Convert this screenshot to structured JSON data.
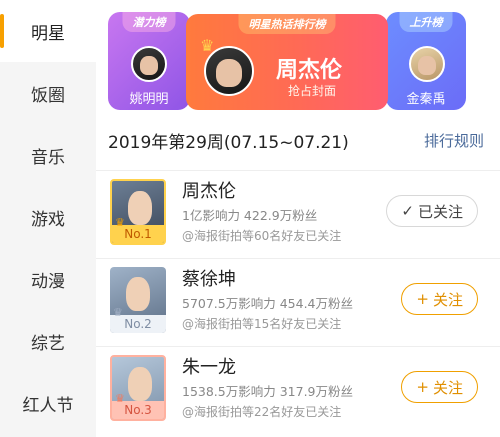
{
  "sidebar": {
    "items": [
      {
        "label": "明星",
        "active": true
      },
      {
        "label": "饭圈"
      },
      {
        "label": "音乐"
      },
      {
        "label": "游戏"
      },
      {
        "label": "动漫"
      },
      {
        "label": "综艺"
      },
      {
        "label": "红人节"
      }
    ]
  },
  "banner": {
    "left": {
      "tag": "潜力榜",
      "name": "姚明明"
    },
    "center": {
      "tag": "明星热话排行榜",
      "name": "周杰伦",
      "sub": "抢占封面"
    },
    "right": {
      "tag": "上升榜",
      "name": "金秦禹"
    }
  },
  "week": {
    "title": "2019年第29周(07.15~07.21)",
    "rule_link": "排行规则"
  },
  "rankings": [
    {
      "rank": "No.1",
      "name": "周杰伦",
      "stats": "1亿影响力  422.9万粉丝",
      "friends": "@海报街拍等60名好友已关注",
      "button": "已关注",
      "button_icon": "✓"
    },
    {
      "rank": "No.2",
      "name": "蔡徐坤",
      "stats": "5707.5万影响力  454.4万粉丝",
      "friends": "@海报街拍等15名好友已关注",
      "button": "关注",
      "button_icon": "+"
    },
    {
      "rank": "No.3",
      "name": "朱一龙",
      "stats": "1538.5万影响力  317.9万粉丝",
      "friends": "@海报街拍等22名好友已关注",
      "button": "关注",
      "button_icon": "+"
    }
  ],
  "icons": {
    "crown": "crown-icon",
    "check": "check-icon",
    "plus": "plus-icon"
  },
  "colors": {
    "accent": "#f7a000",
    "link": "#4a6a9a"
  }
}
